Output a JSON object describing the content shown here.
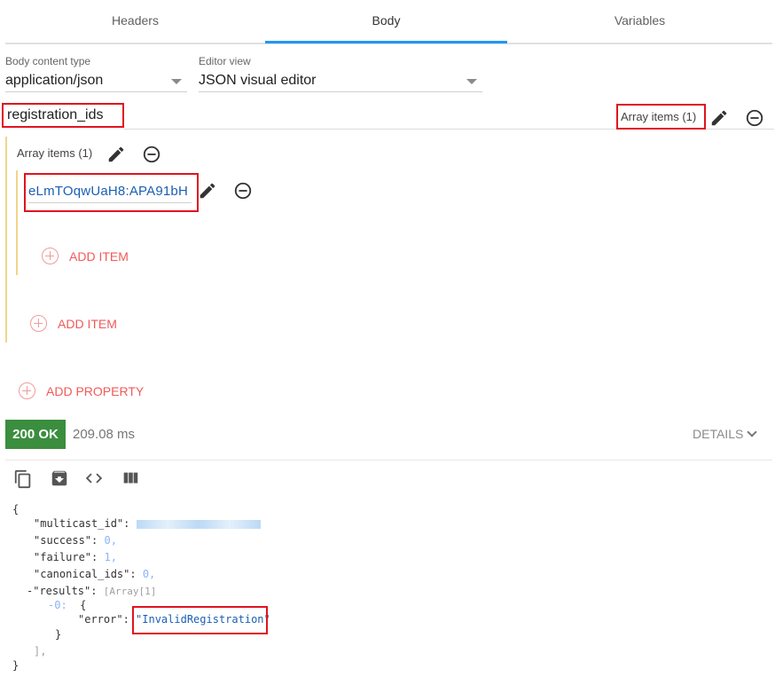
{
  "tabs": [
    {
      "label": "Headers"
    },
    {
      "label": "Body"
    },
    {
      "label": "Variables"
    }
  ],
  "body_content_type": {
    "label": "Body content type",
    "value": "application/json"
  },
  "editor_view": {
    "label": "Editor view",
    "value": "JSON visual editor"
  },
  "property": {
    "name": "registration_ids",
    "array_badge": "Array items (1)"
  },
  "array": {
    "label": "Array items (1)",
    "items": [
      {
        "value": "eLmTOqwUaH8:APA91bH"
      }
    ],
    "add_item_inner": "ADD ITEM",
    "add_item_outer": "ADD ITEM"
  },
  "add_property": "ADD PROPERTY",
  "response": {
    "status": "200 OK",
    "status_color": "#3a8e3e",
    "time": "209.08 ms",
    "details": "DETAILS"
  },
  "toolbar": [
    {
      "icon": "copy-icon"
    },
    {
      "icon": "save-icon"
    },
    {
      "icon": "code-icon"
    },
    {
      "icon": "columns-icon"
    }
  ],
  "json_view": {
    "open_brace": "{",
    "multicast_key": "\"multicast_id\"",
    "success_key": "\"success\"",
    "success_val": "0,",
    "failure_key": "\"failure\"",
    "failure_val": "1,",
    "canonical_key": "\"canonical_ids\"",
    "canonical_val": "0,",
    "results_key": "\"results\"",
    "results_meta": "[Array[1]",
    "index": "-0:",
    "obj_open": "{",
    "error_key": "\"error\"",
    "error_val": "\"InvalidRegistration\"",
    "obj_close": "}",
    "arr_close": "],",
    "close_brace": "}"
  },
  "accent": "#2196f3"
}
